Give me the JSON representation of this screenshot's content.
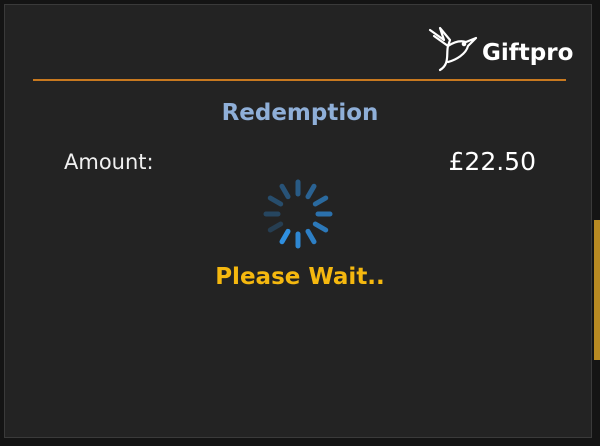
{
  "brand": {
    "name": "Giftpro",
    "logo_icon": "hummingbird-icon"
  },
  "dialog": {
    "title": "Redemption",
    "amount_label": "Amount:",
    "amount_value": "£22.50",
    "status_text": "Please Wait..",
    "spinner_icon": "loading-spinner-icon"
  },
  "colors": {
    "background": "#232323",
    "divider": "#c8791f",
    "title": "#8fafd8",
    "status": "#f5b80f",
    "spinner": "#2f8fe0"
  }
}
